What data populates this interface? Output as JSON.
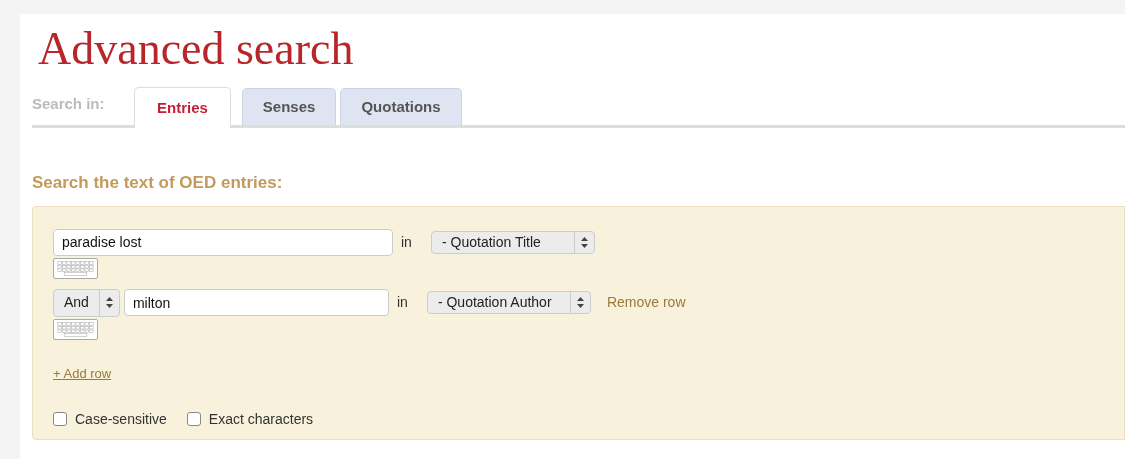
{
  "title": "Advanced search",
  "search_in": {
    "label": "Search in:",
    "tabs": [
      {
        "label": "Entries",
        "selected": true
      },
      {
        "label": "Senses",
        "selected": false
      },
      {
        "label": "Quotations",
        "selected": false
      }
    ]
  },
  "heading": "Search the text of OED entries:",
  "rows": [
    {
      "value": "paradise lost",
      "in_label": "in",
      "field": "- Quotation Title"
    },
    {
      "connector": "And",
      "value": "milton",
      "in_label": "in",
      "field": "- Quotation Author",
      "remove": "Remove row"
    }
  ],
  "add_row": "+ Add row",
  "options": [
    {
      "label": "Case-sensitive",
      "checked": false
    },
    {
      "label": "Exact characters",
      "checked": false
    }
  ]
}
